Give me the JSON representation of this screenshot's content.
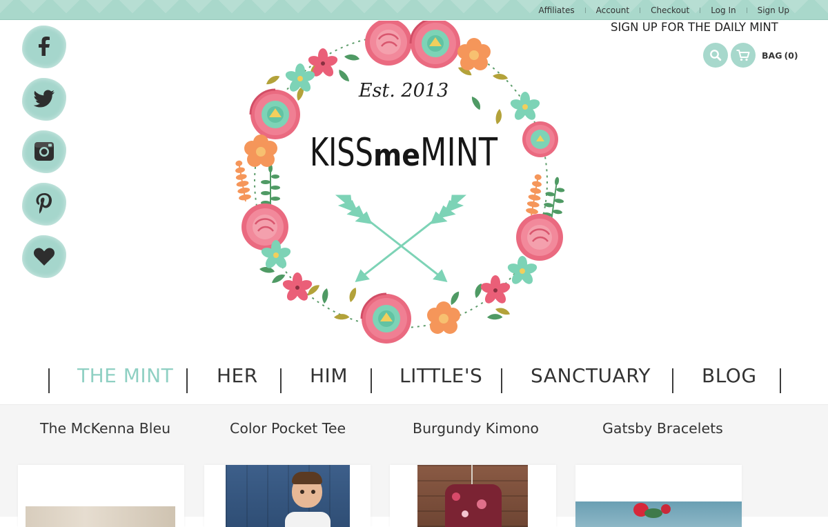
{
  "top_links": [
    "Affiliates",
    "Account",
    "Checkout",
    "Log In",
    "Sign Up"
  ],
  "social_icons": [
    "facebook-icon",
    "twitter-icon",
    "instagram-icon",
    "pinterest-icon",
    "heart-icon"
  ],
  "header": {
    "daily_mint": "SIGN UP FOR THE DAILY MINT",
    "bag_label": "BAG",
    "bag_count": "(0)"
  },
  "logo": {
    "est": "Est. 2013",
    "name_kiss": "KISS",
    "name_me": "me",
    "name_mint": "MINT"
  },
  "nav": {
    "items": [
      "THE MINT",
      "HER",
      "HIM",
      "LITTLE'S",
      "SANCTUARY",
      "BLOG"
    ],
    "active": "THE MINT"
  },
  "products": [
    "The McKenna Bleu",
    "Color Pocket Tee",
    "Burgundy Kimono",
    "Gatsby Bracelets"
  ],
  "colors": {
    "mint": "#a7d8cc",
    "active_nav": "#8fd0c3",
    "pink": "#ea6a80",
    "orange": "#f59a55",
    "leaf": "#4f9a64",
    "olive": "#b3a23a"
  }
}
